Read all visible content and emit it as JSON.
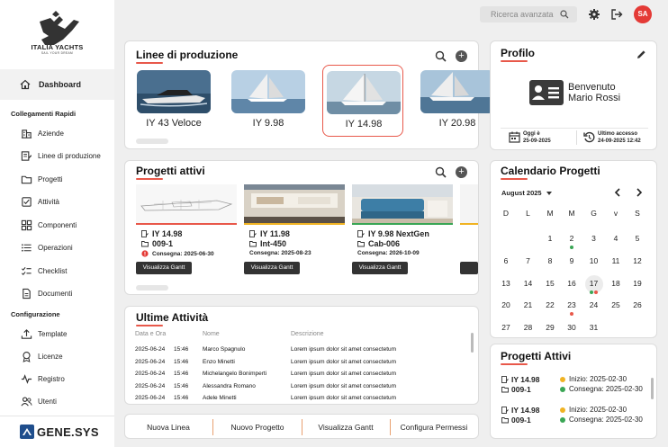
{
  "app": {
    "logo_name": "ITALIA YACHTS",
    "logo_tagline": "SAIL YOUR DREAM",
    "brand_footer": "GENE.SYS",
    "accent": "#e8584a",
    "avatar_bg": "#e43a36"
  },
  "header": {
    "search_placeholder": "Ricerca avanzata",
    "avatar_initials": "SA"
  },
  "sidebar": {
    "dashboard": "Dashboard",
    "section1": "Collegamenti Rapidi",
    "section2": "Configurazione",
    "links": [
      {
        "label": "Aziende",
        "icon": "building-icon"
      },
      {
        "label": "Linee di produzione",
        "icon": "production-line-icon"
      },
      {
        "label": "Progetti",
        "icon": "folder-icon"
      },
      {
        "label": "Attività",
        "icon": "task-icon"
      },
      {
        "label": "Componenti",
        "icon": "components-icon"
      },
      {
        "label": "Operazioni",
        "icon": "operations-icon"
      },
      {
        "label": "Checklist",
        "icon": "checklist-icon"
      },
      {
        "label": "Documenti",
        "icon": "document-icon"
      }
    ],
    "config": [
      {
        "label": "Template",
        "icon": "upload-icon"
      },
      {
        "label": "Licenze",
        "icon": "license-icon"
      },
      {
        "label": "Registro",
        "icon": "log-icon"
      },
      {
        "label": "Utenti",
        "icon": "users-icon"
      }
    ]
  },
  "production": {
    "title": "Linee di produzione",
    "add": "+",
    "items": [
      {
        "label": "IY 43 Veloce",
        "selected": false
      },
      {
        "label": "IY 9.98",
        "selected": false
      },
      {
        "label": "IY 14.98",
        "selected": true
      },
      {
        "label": "IY 20.98",
        "selected": false
      }
    ]
  },
  "projects": {
    "title": "Progetti attivi",
    "add": "+",
    "items": [
      {
        "model": "IY 14.98",
        "code": "009-1",
        "delivery": "Consegna: 2025-06-30",
        "status_color": "#e8584a",
        "alert": true,
        "button": "Visualizza Gantt"
      },
      {
        "model": "IY 11.98",
        "code": "Int-450",
        "delivery": "Consegna: 2025-08-23",
        "status_color": "#f0b323",
        "alert": false,
        "button": "Visualizza Gantt"
      },
      {
        "model": "IY 9.98 NextGen",
        "code": "Cab-006",
        "delivery": "Consegna: 2026-10-09",
        "status_color": "#3aa655",
        "alert": false,
        "button": "Visualizza Gantt"
      }
    ]
  },
  "activities": {
    "title": "Ultime Attività",
    "headers": [
      "Data e Ora",
      "Nome",
      "Descrizione"
    ],
    "rows": [
      {
        "date": "2025-06-24",
        "time": "15:46",
        "name": "Marco Spagnulo",
        "desc": "Lorem ipsum dolor sit amet consectetum"
      },
      {
        "date": "2025-06-24",
        "time": "15:46",
        "name": "Enzo Minetti",
        "desc": "Lorem ipsum dolor sit amet consectetum"
      },
      {
        "date": "2025-06-24",
        "time": "15:46",
        "name": "Michelangelo Bonimperti",
        "desc": "Lorem ipsum dolor sit amet consectetum"
      },
      {
        "date": "2025-06-24",
        "time": "15:46",
        "name": "Alessandra Romano",
        "desc": "Lorem ipsum dolor sit amet consectetum"
      },
      {
        "date": "2025-06-24",
        "time": "15:46",
        "name": "Adele Minetti",
        "desc": "Lorem ipsum dolor sit amet consectetum"
      }
    ]
  },
  "quick_actions": [
    "Nuova Linea",
    "Nuovo Progetto",
    "Visualizza Gantt",
    "Configura Permessi"
  ],
  "profile": {
    "title": "Profilo",
    "welcome": "Benvenuto",
    "name": "Mario Rossi",
    "today_label": "Oggi è",
    "today_date": "25-09-2025",
    "last_label": "Ultimo accesso",
    "last_date": "24-09-2025 12:42"
  },
  "calendar": {
    "title": "Calendario Progetti",
    "month": "August 2025",
    "dow": [
      "D",
      "L",
      "M",
      "M",
      "G",
      "v",
      "S"
    ],
    "weeks": [
      [
        "",
        "",
        "",
        "1",
        "2",
        "3",
        "4",
        "5"
      ],
      [
        "6",
        "7",
        "8",
        "9",
        "10",
        "11",
        "12"
      ],
      [
        "13",
        "14",
        "15",
        "16",
        "17",
        "18",
        "19"
      ],
      [
        "20",
        "21",
        "22",
        "23",
        "24",
        "25",
        "26"
      ],
      [
        "27",
        "28",
        "29",
        "30",
        "31",
        "",
        ""
      ]
    ],
    "today": "17"
  },
  "active_projects": {
    "title": "Progetti Attivi",
    "items": [
      {
        "model": "IY 14.98",
        "code": "009-1",
        "start": "Inizio: 2025-02-30",
        "delivery": "Consegna: 2025-02-30"
      },
      {
        "model": "IY 14.98",
        "code": "009-1",
        "start": "Inizio: 2025-02-30",
        "delivery": "Consegna: 2025-02-30"
      }
    ]
  }
}
